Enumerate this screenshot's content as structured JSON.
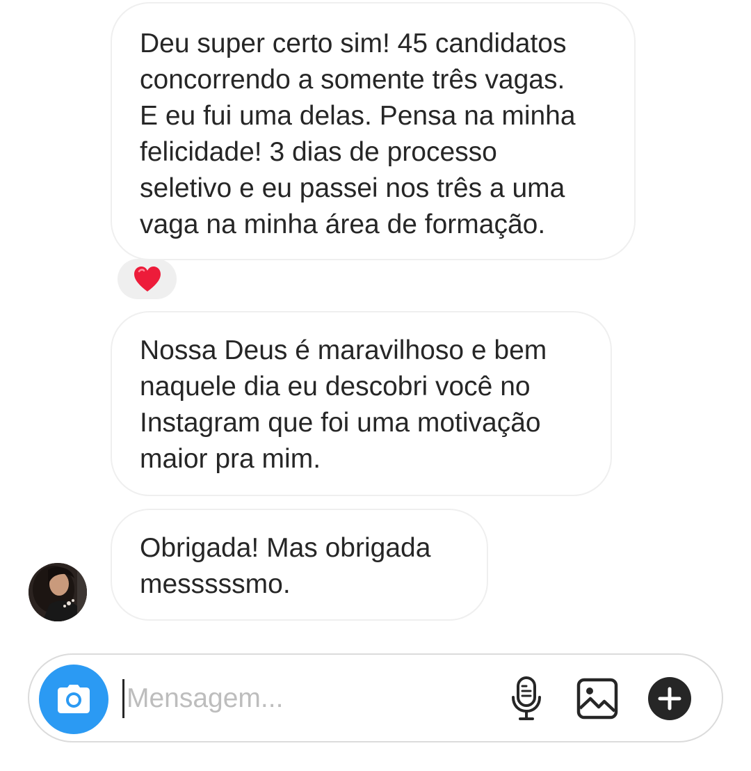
{
  "messages": [
    {
      "text": "Deu super certo sim! 45 candidatos\nconcorrendo a somente três vagas.\nE eu fui uma delas. Pensa na minha\nfelicidade! 3 dias de processo\nseletivo e eu passei nos três a uma\nvaga na minha área de formação.",
      "reaction": "❤️"
    },
    {
      "text": "Nossa Deus é maravilhoso e bem\nnaquele dia eu descobri você no\nInstagram que foi uma motivação\nmaior pra mim."
    },
    {
      "text": "Obrigada! Mas obrigada\nmesssssmo."
    }
  ],
  "composer": {
    "placeholder": "Mensagem...",
    "value": "",
    "icons": [
      "camera-icon",
      "microphone-icon",
      "gallery-icon",
      "plus-icon"
    ]
  },
  "colors": {
    "camera_button": "#2b9af3",
    "bubble_border": "#efefef",
    "reaction_background": "#efefef",
    "text": "#262626",
    "placeholder": "#bdbdbd"
  }
}
